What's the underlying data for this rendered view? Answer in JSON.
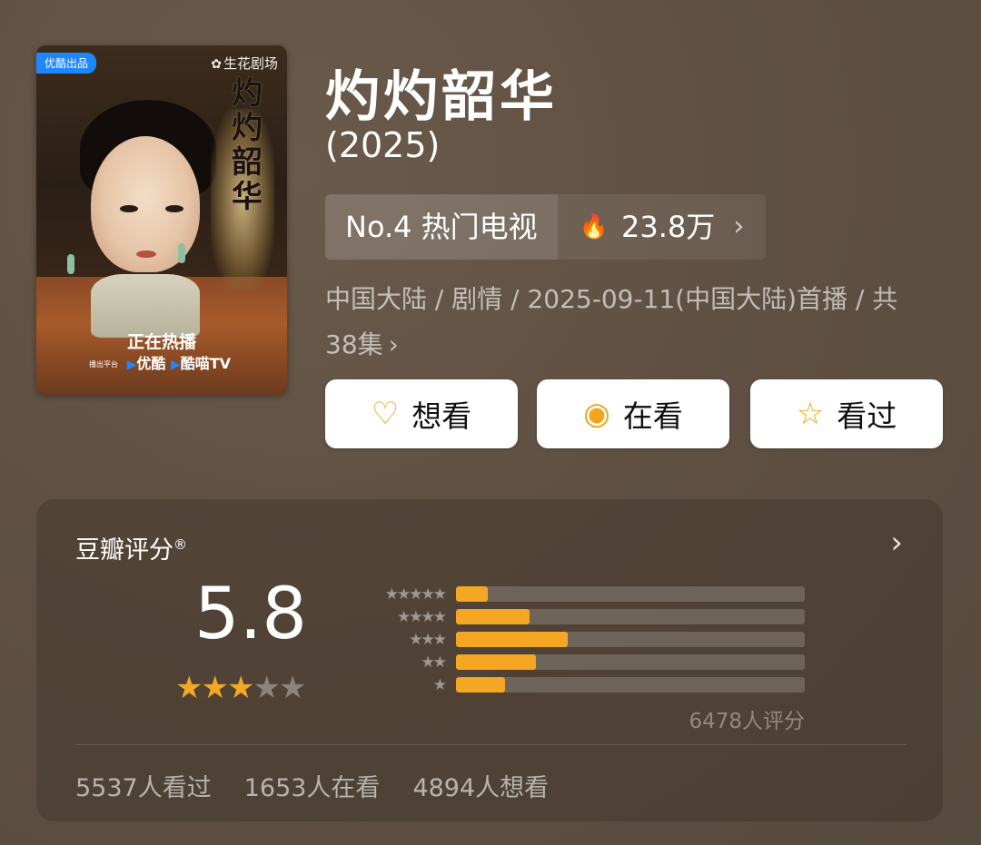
{
  "poster": {
    "badge": "优酷出品",
    "studio": "生花剧场",
    "vertical_title": "灼灼韶华",
    "now_playing": "正在热播",
    "platform_prefix": "播出平台",
    "platform1": "优酷",
    "platform2": "酷喵TV"
  },
  "show": {
    "title": "灼灼韶华",
    "year": "(2025)"
  },
  "rank": {
    "label": "No.4 热门电视",
    "heat": "23.8万"
  },
  "meta": {
    "line": "中国大陆 / 剧情 / 2025-09-11(中国大陆)首播 / 共38集"
  },
  "actions": {
    "want": "想看",
    "watching": "在看",
    "watched": "看过"
  },
  "rating": {
    "header": "豆瓣评分",
    "registered": "®",
    "score": "5.8",
    "stars_filled": 3,
    "stars_total": 5,
    "distribution": [
      {
        "stars": 5,
        "fraction": 0.09
      },
      {
        "stars": 4,
        "fraction": 0.21
      },
      {
        "stars": 3,
        "fraction": 0.32
      },
      {
        "stars": 2,
        "fraction": 0.23
      },
      {
        "stars": 1,
        "fraction": 0.14
      }
    ],
    "count": "6478人评分",
    "accent": "#f5a623"
  },
  "stats": {
    "watched": "5537人看过",
    "watching": "1653人在看",
    "want": "4894人想看"
  }
}
